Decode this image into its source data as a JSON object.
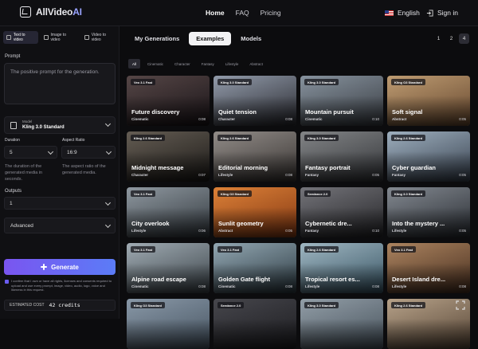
{
  "header": {
    "brand_main": "AllVideo",
    "brand_ai": "AI",
    "nav": [
      "Home",
      "FAQ",
      "Pricing"
    ],
    "active_nav": "Home",
    "language": "English",
    "signin": "Sign in"
  },
  "sidebar": {
    "modes": [
      "Text to video",
      "Image to video",
      "Video to video"
    ],
    "prompt_label": "Prompt",
    "prompt_placeholder": "The positive prompt for the generation.",
    "model_caption": "Model",
    "model_value": "Kling 3.0 Standard",
    "duration_label": "Duration",
    "duration_value": "5",
    "duration_help": "The duration of the generated media in seconds.",
    "aspect_label": "Aspect Ratio",
    "aspect_value": "16:9",
    "aspect_help": "The aspect ratio of the generated media.",
    "outputs_label": "Outputs",
    "outputs_value": "1",
    "advanced_label": "Advanced",
    "generate_label": "Generate",
    "consent_text": "I confirm that I own or have all rights, licenses and consents required to upload and use every prompt, image, video, audio, logo, voice and likeness in this request.",
    "cost_label": "ESTIMATED COST",
    "cost_value": "42 credits"
  },
  "main": {
    "tabs": [
      "My Generations",
      "Examples",
      "Models"
    ],
    "active_tab": "Examples",
    "pages": [
      "1",
      "2",
      "4"
    ],
    "active_page": "4",
    "filters": [
      "All",
      "Cinematic",
      "Character",
      "Fantasy",
      "Lifestyle",
      "Abstract"
    ],
    "active_filter": "All",
    "cards": [
      {
        "badge": "Veo 3.1 Fast",
        "title": "Future discovery",
        "category": "Cinematic",
        "duration": "0:08",
        "c1": "#5a4a4a",
        "c2": "#1a1418"
      },
      {
        "badge": "Kling 3.0 Standard",
        "title": "Quiet tension",
        "category": "Character",
        "duration": "0:08",
        "c1": "#9aa4b4",
        "c2": "#2a2a30"
      },
      {
        "badge": "Kling 3.0 Standard",
        "title": "Mountain pursuit",
        "category": "Cinematic",
        "duration": "0:10",
        "c1": "#8e9aa6",
        "c2": "#3a3e44"
      },
      {
        "badge": "Kling O3 Standard",
        "title": "Soft signal",
        "category": "Abstract",
        "duration": "0:05",
        "c1": "#c8a478",
        "c2": "#6a4a30"
      },
      {
        "badge": "Kling 2.6 Standard",
        "title": "Midnight message",
        "category": "Character",
        "duration": "0:07",
        "c1": "#6a6258",
        "c2": "#1c1a18"
      },
      {
        "badge": "Kling 2.6 Standard",
        "title": "Editorial morning",
        "category": "Lifestyle",
        "duration": "0:08",
        "c1": "#9a9490",
        "c2": "#3a3634"
      },
      {
        "badge": "Kling 3.0 Standard",
        "title": "Fantasy portrait",
        "category": "Fantasy",
        "duration": "0:05",
        "c1": "#8a8c8e",
        "c2": "#34363a"
      },
      {
        "badge": "Kling 2.6 Standard",
        "title": "Cyber guardian",
        "category": "Fantasy",
        "duration": "0:05",
        "c1": "#a6b8c8",
        "c2": "#3a4452"
      },
      {
        "badge": "Veo 3.1 Fast",
        "title": "City overlook",
        "category": "Lifestyle",
        "duration": "0:06",
        "c1": "#96a0a8",
        "c2": "#343a40"
      },
      {
        "badge": "Kling O3 Standard",
        "title": "Sunlit geometry",
        "category": "Abstract",
        "duration": "0:05",
        "c1": "#e8883a",
        "c2": "#8a3a14"
      },
      {
        "badge": "Seedance 2.0",
        "title": "Cybernetic dre...",
        "category": "Fantasy",
        "duration": "0:10",
        "c1": "#7a7a80",
        "c2": "#262629"
      },
      {
        "badge": "Kling 3.0 Standard",
        "title": "Into the mystery ...",
        "category": "Lifestyle",
        "duration": "0:05",
        "c1": "#8a9098",
        "c2": "#2a2e34"
      },
      {
        "badge": "Veo 3.1 Fast",
        "title": "Alpine road escape",
        "category": "Cinematic",
        "duration": "0:08",
        "c1": "#a8b4bc",
        "c2": "#3e464c"
      },
      {
        "badge": "Veo 3.1 Fast",
        "title": "Golden Gate flight",
        "category": "Cinematic",
        "duration": "0:08",
        "c1": "#9ab0bc",
        "c2": "#2e3c44"
      },
      {
        "badge": "Kling 2.6 Standard",
        "title": "Tropical resort es...",
        "category": "Lifestyle",
        "duration": "0:08",
        "c1": "#a8c0cc",
        "c2": "#3a5868"
      },
      {
        "badge": "Veo 3.1 Fast",
        "title": "Desert Island dre...",
        "category": "Lifestyle",
        "duration": "0:08",
        "c1": "#b48a64",
        "c2": "#4a3020"
      },
      {
        "badge": "Kling O3 Standard",
        "title": "",
        "category": "",
        "duration": "",
        "c1": "#90a0b0",
        "c2": "#4a5866"
      },
      {
        "badge": "Seedance 2.0",
        "title": "",
        "category": "",
        "duration": "",
        "c1": "#4a4a50",
        "c2": "#1e1e22"
      },
      {
        "badge": "Kling 3.0 Standard",
        "title": "",
        "category": "",
        "duration": "",
        "c1": "#9aa6b0",
        "c2": "#4a5660"
      },
      {
        "badge": "Kling 2.6 Standard",
        "title": "",
        "category": "",
        "duration": "",
        "c1": "#c0aa90",
        "c2": "#5a4838"
      }
    ]
  }
}
